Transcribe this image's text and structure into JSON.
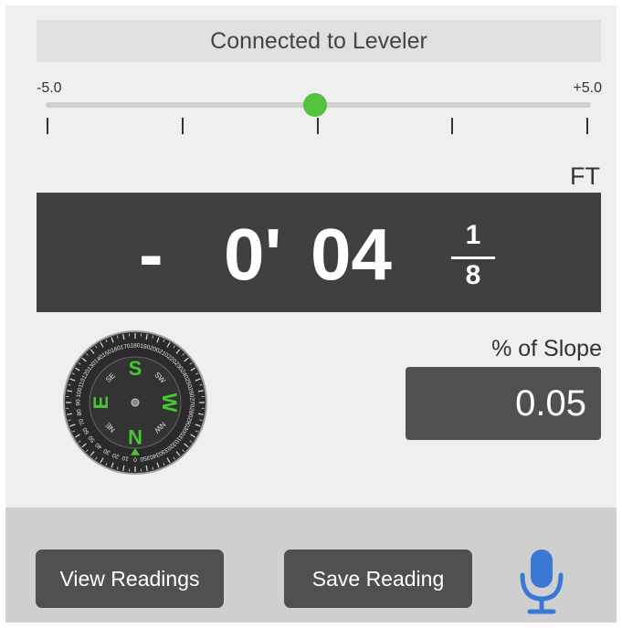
{
  "status": {
    "text": "Connected to Leveler"
  },
  "level_scale": {
    "min_label": "-5.0",
    "max_label": "+5.0",
    "min": -5.0,
    "max": 5.0,
    "value": -0.05,
    "tick_count": 5,
    "track_color": "#cfcfcf",
    "knob_color": "#54c23f"
  },
  "measurement": {
    "unit": "FT",
    "sign": "-",
    "feet": "0'",
    "inches": "04",
    "fraction_numerator": "1",
    "fraction_denominator": "8"
  },
  "compass": {
    "cardinals": [
      "S",
      "W",
      "N",
      "E"
    ],
    "intercardinals": [
      "SE",
      "SW",
      "NW",
      "NE"
    ],
    "degree_labels": [
      "0",
      "10",
      "20",
      "30",
      "40",
      "50",
      "60",
      "70",
      "80",
      "90",
      "100",
      "110",
      "120",
      "130",
      "140",
      "150",
      "160",
      "170",
      "180",
      "190",
      "200",
      "210",
      "220",
      "230",
      "240",
      "250",
      "260",
      "270",
      "280",
      "290",
      "300",
      "310",
      "320",
      "330",
      "340",
      "350"
    ],
    "heading_deg": 180,
    "accent_color": "#46c832",
    "face_color": "#2b2b2b"
  },
  "slope": {
    "label": "% of Slope",
    "value": "0.05"
  },
  "actions": {
    "view_readings": "View Readings",
    "save_reading": "Save Reading",
    "mic_icon": "microphone-icon",
    "mic_color": "#3a78d6"
  }
}
